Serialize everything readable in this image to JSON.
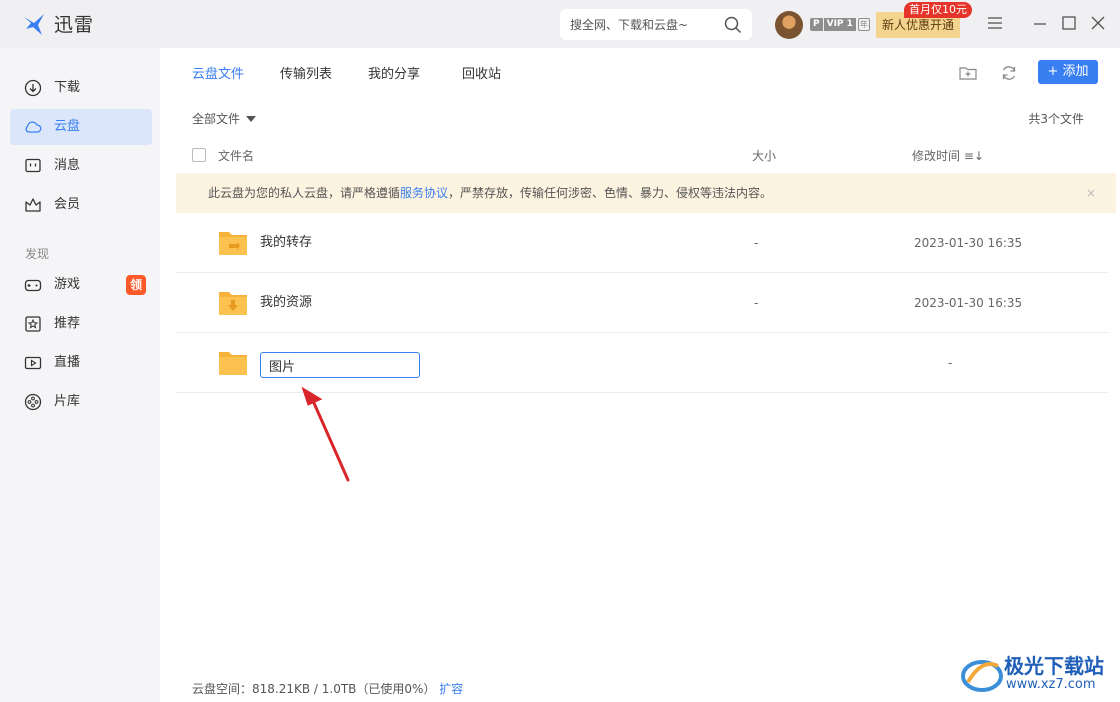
{
  "app": {
    "name": "迅雷"
  },
  "search": {
    "placeholder": "搜全网、下载和云盘~"
  },
  "account": {
    "vip_p": "P",
    "vip_level": "VIP 1",
    "vip_period": "年",
    "promo_label": "新人优惠开通",
    "promo_tag": "首月仅10元"
  },
  "sidebar": {
    "items": [
      {
        "label": "下载",
        "icon": "download-icon"
      },
      {
        "label": "云盘",
        "icon": "cloud-icon"
      },
      {
        "label": "消息",
        "icon": "message-icon"
      },
      {
        "label": "会员",
        "icon": "crown-icon"
      }
    ],
    "section": "发现",
    "discover": [
      {
        "label": "游戏",
        "icon": "gamepad-icon",
        "badge": "领"
      },
      {
        "label": "推荐",
        "icon": "star-icon"
      },
      {
        "label": "直播",
        "icon": "live-icon"
      },
      {
        "label": "片库",
        "icon": "film-reel-icon"
      }
    ]
  },
  "tabs": [
    "云盘文件",
    "传输列表",
    "我的分享",
    "回收站"
  ],
  "toolbar": {
    "add_label": "+ 添加"
  },
  "filter": {
    "label": "全部文件"
  },
  "count": "共3个文件",
  "columns": {
    "name": "文件名",
    "size": "大小",
    "modified": "修改时间 ≡↓"
  },
  "notice": {
    "before": "此云盘为您的私人云盘，请严格遵循",
    "link": "服务协议",
    "after": "，严禁存放，传输任何涉密、色情、暴力、侵权等违法内容。",
    "close": "×"
  },
  "files": [
    {
      "name": "我的转存",
      "size": "-",
      "modified": "2023-01-30 16:35",
      "icon": "folder-transfer-icon"
    },
    {
      "name": "我的资源",
      "size": "-",
      "modified": "2023-01-30 16:35",
      "icon": "folder-download-icon"
    }
  ],
  "new_folder": {
    "value": "图片",
    "size": "-"
  },
  "storage": {
    "text": "云盘空间：818.21KB / 1.0TB（已使用0%）",
    "link": "扩容"
  },
  "watermark": {
    "title": "极光下载站",
    "url": "www.xz7.com"
  },
  "colors": {
    "accent": "#3a7ff2",
    "folder": "#f7b23b",
    "notice_bg": "#fdf3e1",
    "annotation": "#d9262a"
  }
}
